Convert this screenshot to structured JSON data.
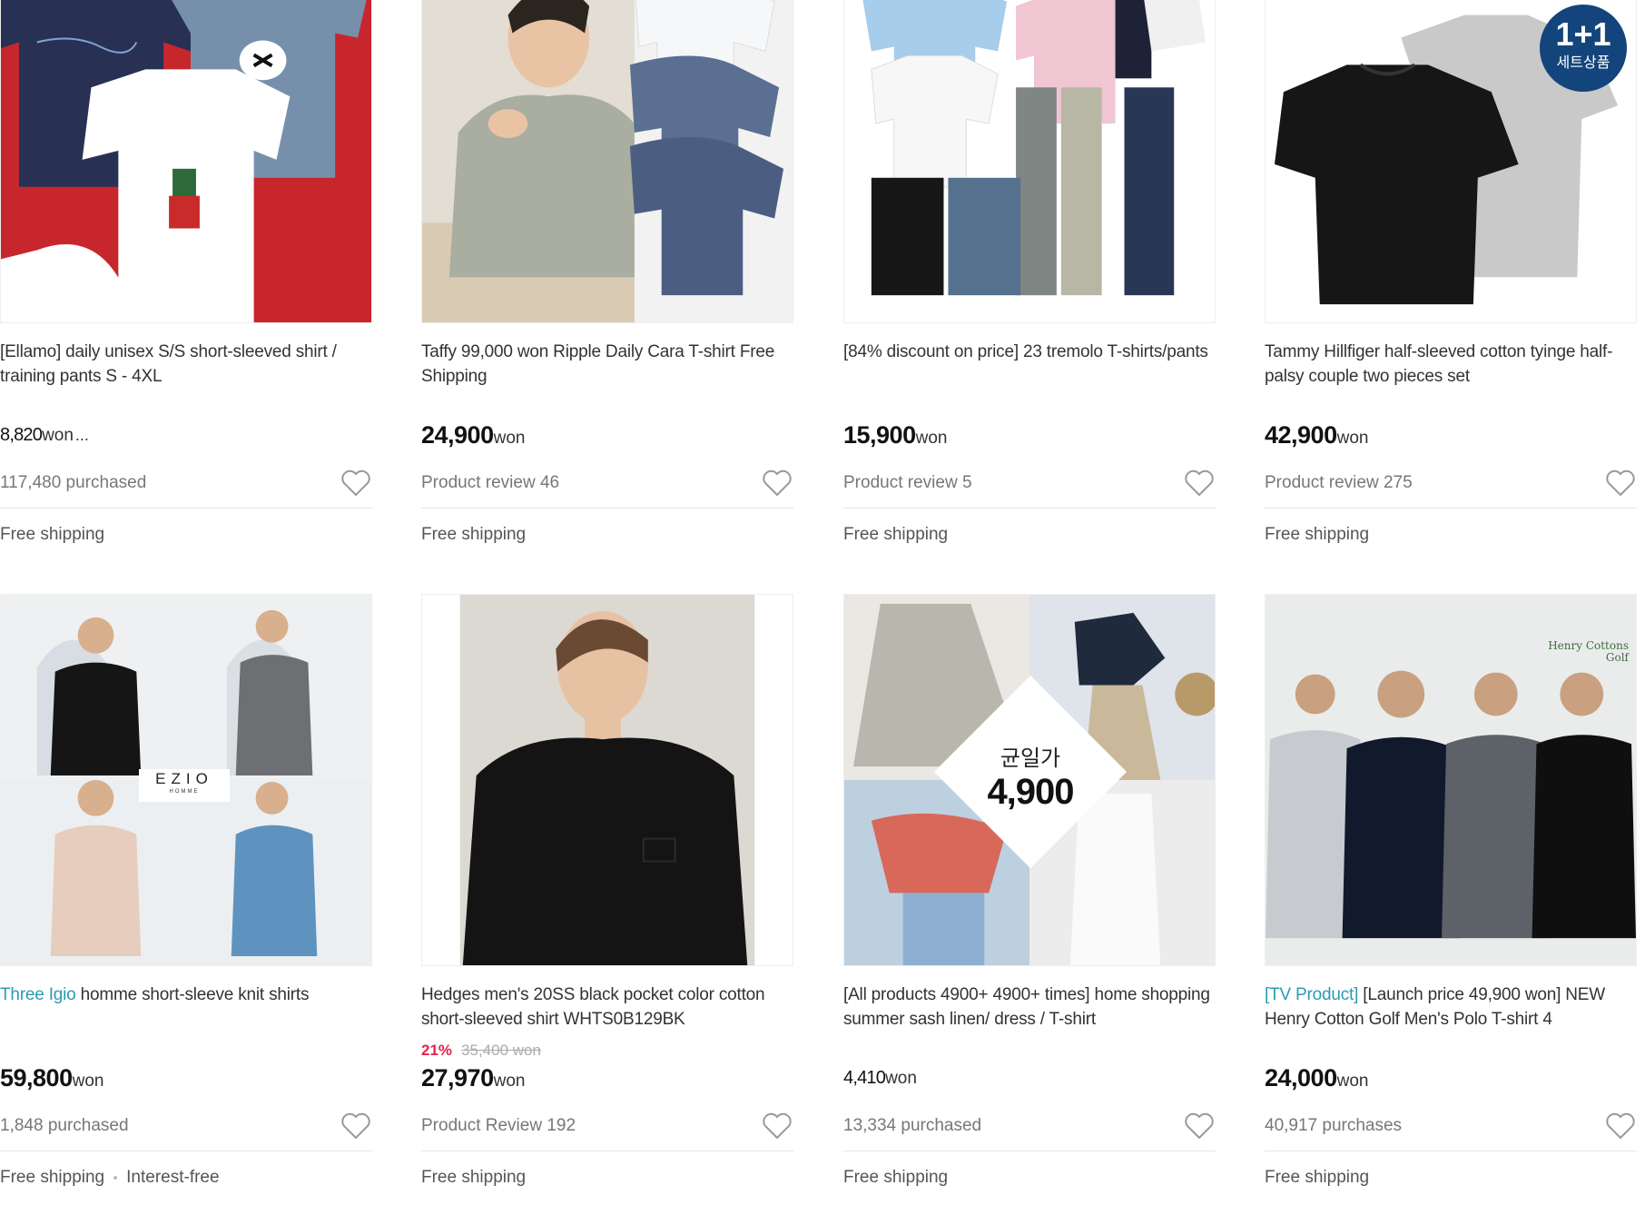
{
  "products": [
    {
      "title": "[Ellamo] daily unisex S/S short-sleeved shirt / training pants S - 4XL",
      "title_prefix": "",
      "price": "8,820",
      "price_unit": "won",
      "price_suffix": "...",
      "meta": "117,480 purchased",
      "shipping": "Free shipping",
      "image": "tshirts-red-background"
    },
    {
      "title": "Taffy 99,000 won Ripple Daily Cara T-shirt Free Shipping",
      "title_prefix": "",
      "price": "24,900",
      "price_unit": "won",
      "meta": "Product review 46",
      "shipping": "Free shipping",
      "image": "man-polo-shirts"
    },
    {
      "title": "[84% discount on price] 23 tremolo T-shirts/pants",
      "title_prefix": "",
      "price": "15,900",
      "price_unit": "won",
      "meta": "Product review 5",
      "shipping": "Free shipping",
      "image": "shirts-and-pants-collection"
    },
    {
      "title": "Tammy Hillfiger half-sleeved cotton tyinge half-palsy couple two pieces set",
      "title_prefix": "",
      "price": "42,900",
      "price_unit": "won",
      "meta": "Product review 275",
      "shipping": "Free shipping",
      "image": "black-grey-tshirts",
      "badge_line1": "1+1",
      "badge_line2": "세트상품"
    },
    {
      "title": "homme short-sleeve knit shirts",
      "title_prefix": "Three Igio",
      "price": "59,800",
      "price_unit": "won",
      "meta": "1,848 purchased",
      "shipping": "Free shipping",
      "shipping_extra": "Interest-free",
      "image": "ezio-homme-models",
      "logo_line1": "EZIO",
      "logo_line2": "HOMME"
    },
    {
      "title": "Hedges men's 20SS black pocket color cotton short-sleeved shirt WHTS0B129BK",
      "title_prefix": "",
      "discount_pct": "21%",
      "original_price": "35,400 won",
      "price": "27,970",
      "price_unit": "won",
      "meta": "Product Review 192",
      "shipping": "Free shipping",
      "image": "man-black-tshirt"
    },
    {
      "title": "[All products 4900+ 4900+ times] home shopping summer sash linen/ dress / T-shirt",
      "title_prefix": "",
      "price": "4,410",
      "price_unit": "won",
      "meta": "13,334 purchased",
      "shipping": "Free shipping",
      "image": "women-fashion-collage",
      "promo_line1": "균일가",
      "promo_line2": "4,900"
    },
    {
      "title": "[Launch price 49,900 won] NEW Henry Cotton Golf Men's Polo T-shirt 4",
      "title_prefix": "[TV Product]",
      "price": "24,000",
      "price_unit": "won",
      "meta": "40,917 purchases",
      "shipping": "Free shipping",
      "image": "four-men-polo-shirts",
      "logo_line1": "Henry Cottons",
      "logo_line2": "Golf"
    }
  ],
  "colors": {
    "accent_link": "#2a9bb5",
    "discount_red": "#e2264d",
    "badge_navy": "#13457c"
  }
}
